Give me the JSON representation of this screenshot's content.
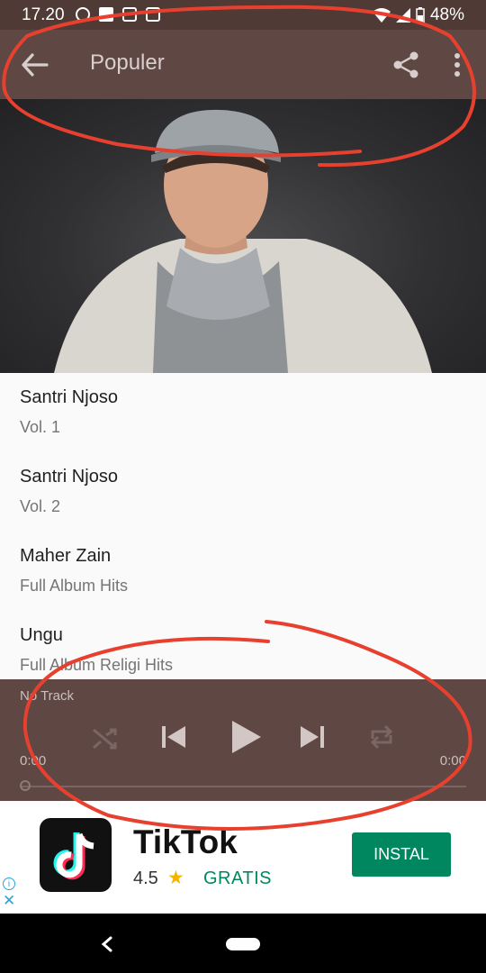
{
  "status": {
    "time": "17.20",
    "battery": "48%"
  },
  "appbar": {
    "title": "Populer"
  },
  "albums": [
    {
      "title": "Santri Njoso",
      "subtitle": "Vol. 1"
    },
    {
      "title": "Santri Njoso",
      "subtitle": "Vol. 2"
    },
    {
      "title": "Maher Zain",
      "subtitle": "Full Album Hits"
    },
    {
      "title": "Ungu",
      "subtitle": "Full Album Religi Hits"
    }
  ],
  "player": {
    "track": "No Track",
    "time_left": "0:00",
    "time_right": "0:00",
    "progress": 0
  },
  "ad": {
    "app": "TikTok",
    "rating": "4.5",
    "price": "GRATIS",
    "button": "INSTAL"
  },
  "colors": {
    "appbar": "#5f4744",
    "ad_button": "#00875f",
    "annotation": "#e8402f"
  }
}
